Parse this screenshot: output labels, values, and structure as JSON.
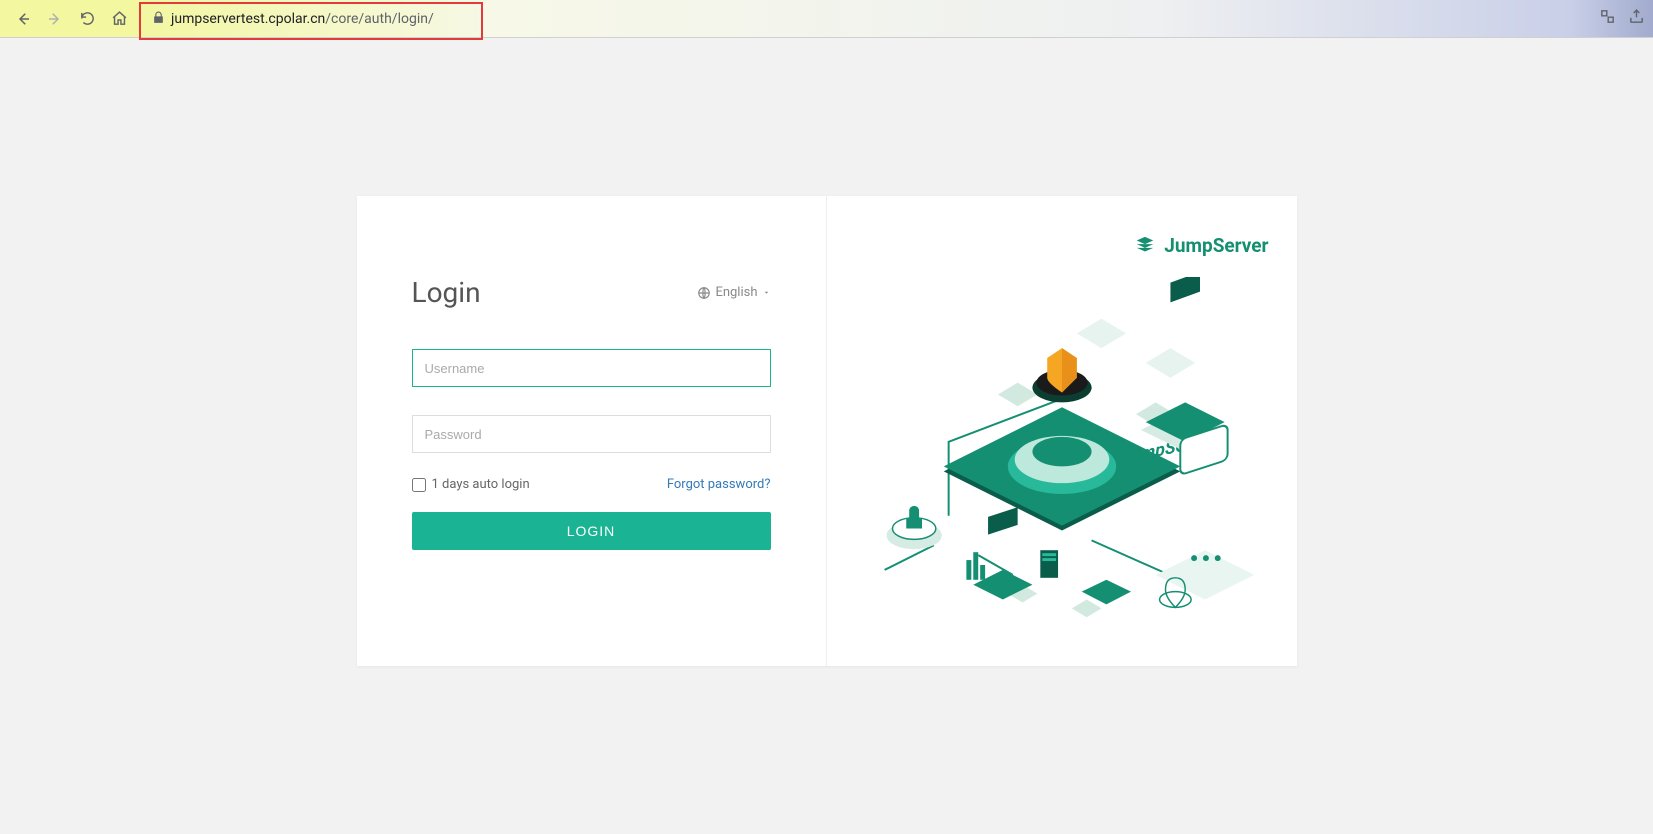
{
  "browser": {
    "url_domain": "jumpservertest.cpolar.cn",
    "url_path": "/core/auth/login/"
  },
  "login": {
    "title": "Login",
    "language": "English",
    "username_placeholder": "Username",
    "password_placeholder": "Password",
    "auto_login_label": "1 days auto login",
    "forgot_password_label": "Forgot password?",
    "login_button_label": "LOGIN"
  },
  "brand": {
    "name": "JumpServer"
  },
  "colors": {
    "primary": "#1ab394",
    "link": "#337ab7",
    "highlight_border": "#e23b3b"
  }
}
